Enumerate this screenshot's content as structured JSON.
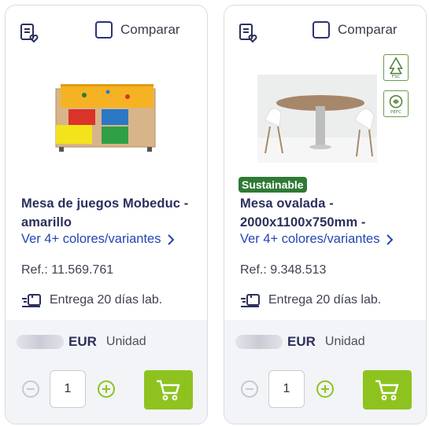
{
  "products": [
    {
      "compare_label": "Comparar",
      "title_line1": "Mesa de juegos Mobeduc -",
      "title_line2": "amarillo",
      "variants_link": "Ver 4+ colores/variantes",
      "ref": "Ref.: 11.569.761",
      "delivery": "Entrega 20 días lab.",
      "currency": "EUR",
      "unit": "Unidad",
      "quantity": "1",
      "icons": {
        "wishlist": "wishlist-icon",
        "chevron": "chevron-right-icon",
        "truck": "truck-icon",
        "minus": "minus-circle-icon",
        "plus": "plus-circle-icon",
        "cart": "cart-icon"
      },
      "image_desc": "Play table with colored bins"
    },
    {
      "compare_label": "Comparar",
      "badge": "Sustainable",
      "title_line1": "Mesa ovalada -",
      "title_line2": "2000x1100x750mm -",
      "variants_link": "Ver 4+ colores/variantes",
      "ref": "Ref.: 9.348.513",
      "delivery": "Entrega 20 días lab.",
      "currency": "EUR",
      "unit": "Unidad",
      "quantity": "1",
      "certifications": [
        "FSC",
        "PEFC"
      ],
      "icons": {
        "wishlist": "wishlist-icon",
        "chevron": "chevron-right-icon",
        "truck": "truck-icon",
        "minus": "minus-circle-icon",
        "plus": "plus-circle-icon",
        "cart": "cart-icon"
      },
      "image_desc": "Oval meeting table with white chairs"
    }
  ],
  "colors": {
    "accent_green": "#8ec31f",
    "sustainable_green": "#2f7a35",
    "title_navy": "#2b2f5c",
    "link_blue": "#2346b3"
  }
}
